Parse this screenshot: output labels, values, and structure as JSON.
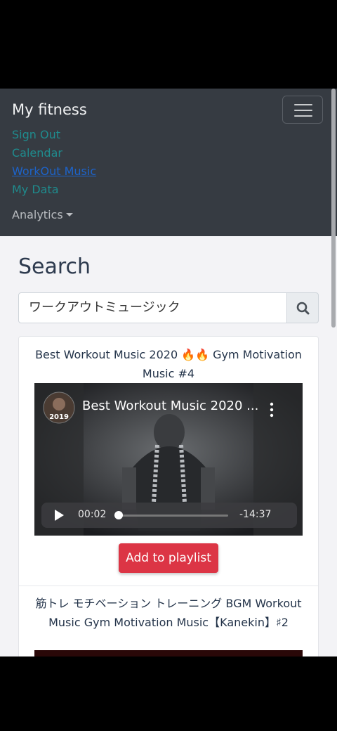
{
  "navbar": {
    "brand": "My fitness",
    "links": [
      "Sign Out",
      "Calendar",
      "WorkOut Music",
      "My Data"
    ],
    "dropdown_label": "Analytics"
  },
  "search": {
    "title": "Search",
    "query": "ワークアウトミュージック"
  },
  "results": [
    {
      "title": "Best Workout Music 2020 🔥🔥 Gym Motivation Music #4",
      "player_title": "Best Workout Music 2020 ...",
      "channel_badge": "2019",
      "elapsed": "00:02",
      "remaining": "-14:37",
      "progress": 0.01,
      "button_label": "Add to playlist"
    },
    {
      "title": "筋トレ モチベーション トレーニング BGM Workout Music Gym Motivation Music【Kanekin】♯2"
    }
  ],
  "colors": {
    "navbar_bg": "#363b42",
    "link": "#1f8b8d",
    "active_link": "#1d63c9",
    "danger": "#dc3545"
  }
}
